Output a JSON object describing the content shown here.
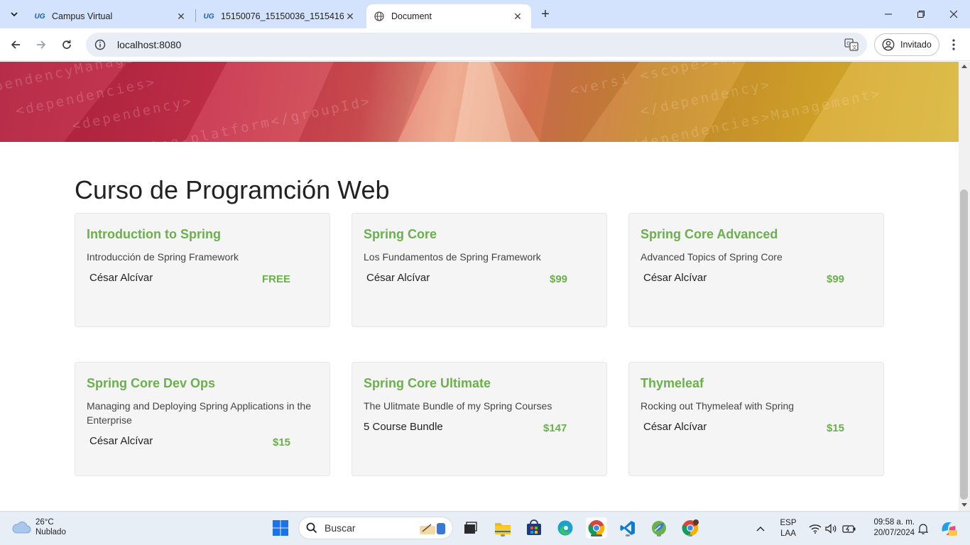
{
  "browser": {
    "tabs": [
      {
        "title": "Campus Virtual",
        "favicon": "ug-logo-icon",
        "active": false
      },
      {
        "title": "15150076_15150036_15154168",
        "favicon": "ug-logo-icon",
        "active": false
      },
      {
        "title": "Document",
        "favicon": "globe-icon",
        "active": true
      }
    ],
    "address": "localhost:8080",
    "profile_label": "Invitado"
  },
  "page": {
    "title": "Curso de Programción Web",
    "courses": [
      {
        "title": "Introduction to Spring",
        "description": "Introducción de Spring Framework",
        "author": "César Alcívar",
        "price": "FREE"
      },
      {
        "title": "Spring Core",
        "description": "Los Fundamentos de Spring Framework",
        "author": "César Alcívar",
        "price": "$99"
      },
      {
        "title": "Spring Core Advanced",
        "description": "Advanced Topics of Spring Core",
        "author": "César Alcívar",
        "price": "$99"
      },
      {
        "title": "Spring Core Dev Ops",
        "description": "Managing and Deploying Spring Applications in the Enterprise",
        "author": "César Alcívar",
        "price": "$15"
      },
      {
        "title": "Spring Core Ultimate",
        "description": "The Ulitmate Bundle of my Spring Courses",
        "author": "5 Course Bundle",
        "price": "$147"
      },
      {
        "title": "Thymeleaf",
        "description": "Rocking out Thymeleaf with Spring",
        "author": "César Alcívar",
        "price": "$15"
      }
    ],
    "accent_color": "#6ab04c"
  },
  "taskbar": {
    "weather": {
      "temperature": "26°C",
      "condition": "Nublado"
    },
    "search_placeholder": "Buscar",
    "language": {
      "line1": "ESP",
      "line2": "LAA"
    },
    "time": "09:58 a. m.",
    "date": "20/07/2024"
  }
}
